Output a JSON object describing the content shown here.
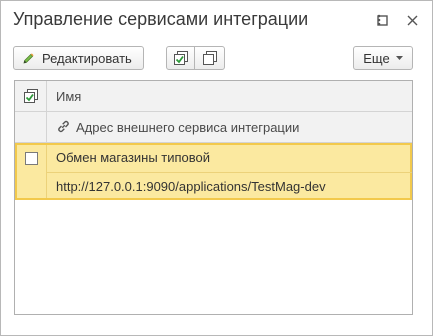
{
  "window": {
    "title": "Управление сервисами интеграции"
  },
  "toolbar": {
    "edit_label": "Редактировать",
    "more_label": "Еще"
  },
  "table": {
    "header_name": "Имя",
    "header_address": "Адрес внешнего сервиса интеграции",
    "rows": [
      {
        "name": "Обмен магазины типовой",
        "address": "http://127.0.0.1:9090/applications/TestMag-dev",
        "checked": false
      }
    ]
  },
  "colors": {
    "selected_row": "#fbe9a0",
    "selected_border": "#f2c94c",
    "header_bg": "#f2f2f2",
    "check_green": "#4caf50"
  },
  "icons": {
    "edit": "pencil-icon",
    "check_all": "check-all-icon",
    "uncheck_all": "uncheck-all-icon",
    "more_menu": "kebab-menu-icon",
    "maximize": "maximize-icon",
    "close": "close-icon",
    "link": "link-icon"
  }
}
